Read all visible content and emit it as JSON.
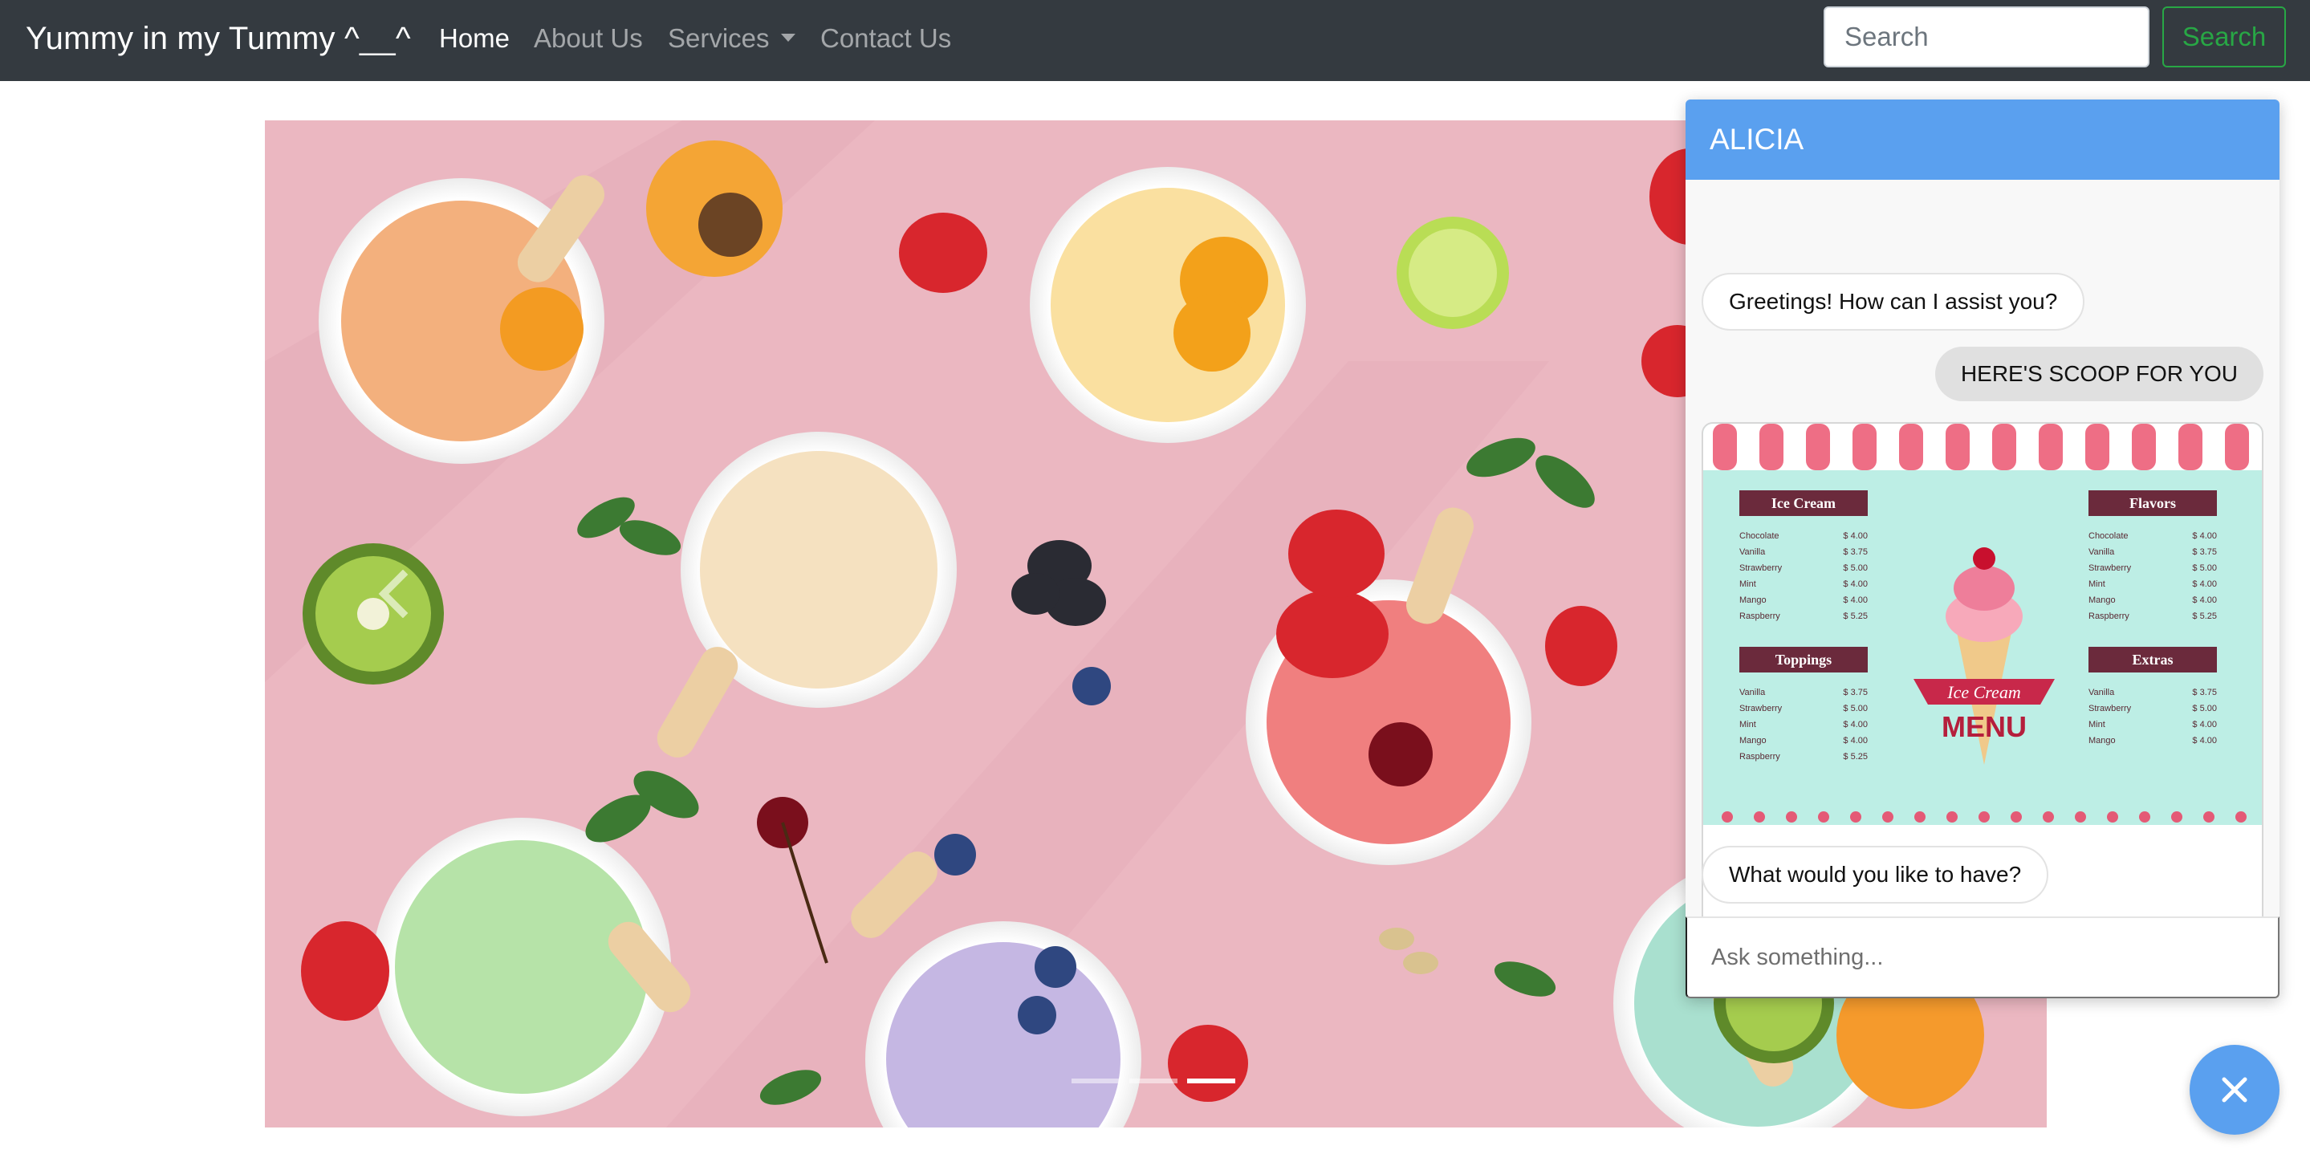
{
  "navbar": {
    "brand": "Yummy in my Tummy ^__^",
    "links": [
      {
        "label": "Home",
        "active": true
      },
      {
        "label": "About Us",
        "active": false
      },
      {
        "label": "Services",
        "active": false
      },
      {
        "label": "Contact Us",
        "active": false
      }
    ],
    "search_placeholder": "Search",
    "search_button": "Search"
  },
  "carousel": {
    "prev_icon": "chevron-left-icon",
    "slide_count": 3,
    "active_slide": 3
  },
  "chat": {
    "title": "ALICIA",
    "messages": [
      {
        "from": "bot",
        "text": "Greetings! How can I assist you?"
      },
      {
        "from": "user",
        "text": "HERE'S SCOOP FOR YOU"
      },
      {
        "from": "bot",
        "text": "What would you like to have?"
      }
    ],
    "menu_image": {
      "title_line1": "Ice Cream",
      "title_line2": "MENU",
      "sections": [
        {
          "title": "Ice Cream",
          "items": [
            [
              "Chocolate",
              "$ 4.00"
            ],
            [
              "Vanilla",
              "$ 3.75"
            ],
            [
              "Strawberry",
              "$ 5.00"
            ],
            [
              "Mint",
              "$ 4.00"
            ],
            [
              "Mango",
              "$ 4.00"
            ],
            [
              "Raspberry",
              "$ 5.25"
            ]
          ]
        },
        {
          "title": "Flavors",
          "items": [
            [
              "Chocolate",
              "$ 4.00"
            ],
            [
              "Vanilla",
              "$ 3.75"
            ],
            [
              "Strawberry",
              "$ 5.00"
            ],
            [
              "Mint",
              "$ 4.00"
            ],
            [
              "Mango",
              "$ 4.00"
            ],
            [
              "Raspberry",
              "$ 5.25"
            ]
          ]
        },
        {
          "title": "Toppings",
          "items": [
            [
              "Vanilla",
              "$ 3.75"
            ],
            [
              "Strawberry",
              "$ 5.00"
            ],
            [
              "Mint",
              "$ 4.00"
            ],
            [
              "Mango",
              "$ 4.00"
            ],
            [
              "Raspberry",
              "$ 5.25"
            ]
          ]
        },
        {
          "title": "Extras",
          "items": [
            [
              "Vanilla",
              "$ 3.75"
            ],
            [
              "Strawberry",
              "$ 5.00"
            ],
            [
              "Mint",
              "$ 4.00"
            ],
            [
              "Mango",
              "$ 4.00"
            ]
          ]
        }
      ]
    },
    "input_placeholder": "Ask something..."
  },
  "fab": {
    "icon": "close-icon"
  },
  "colors": {
    "navbar_bg": "#343a40",
    "chat_accent": "#5aa0ef",
    "search_button": "#28a745",
    "carousel_bg": "#e9b6c0"
  }
}
